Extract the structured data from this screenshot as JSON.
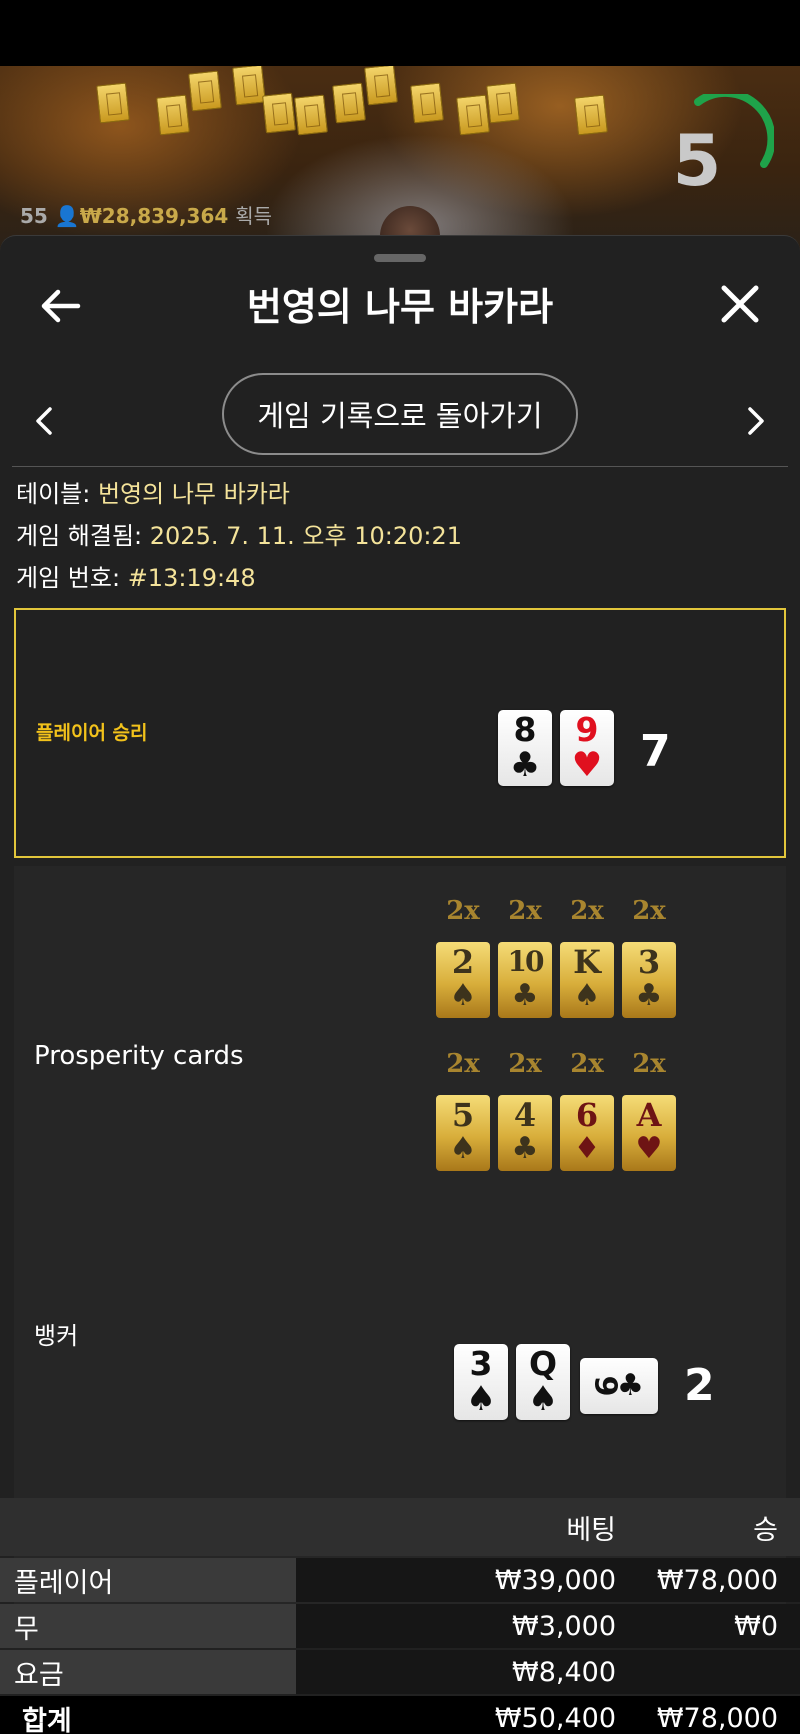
{
  "scene": {
    "lantern_icons": "lantern",
    "timer": "5",
    "player_count": "55",
    "winnings": "₩28,839,364",
    "winnings_suffix": "획득"
  },
  "header": {
    "title": "번영의 나무 바카라",
    "back_icon": "arrow-left-icon",
    "close_icon": "close-icon"
  },
  "nav": {
    "back_to_history": "게임 기록으로 돌아가기",
    "prev_icon": "chevron-left-icon",
    "next_icon": "chevron-right-icon"
  },
  "meta": {
    "table_label": "테이블:",
    "table_value": "번영의 나무 바카라",
    "resolved_label": "게임 해결됨:",
    "resolved_value": "2025. 7. 11. 오후 10:20:21",
    "number_label": "게임 번호:",
    "number_value": "#13:19:48"
  },
  "player": {
    "outcome": "플레이어 승리",
    "cards": [
      {
        "rank": "8",
        "suit": "♣",
        "color": "black"
      },
      {
        "rank": "9",
        "suit": "♥",
        "color": "red"
      }
    ],
    "score": "7"
  },
  "prosperity": {
    "label": "Prosperity cards",
    "rows": [
      [
        {
          "mult": "2x",
          "rank": "2",
          "suit": "♠",
          "color": "dark"
        },
        {
          "mult": "2x",
          "rank": "10",
          "suit": "♣",
          "color": "dark"
        },
        {
          "mult": "2x",
          "rank": "K",
          "suit": "♠",
          "color": "dark"
        },
        {
          "mult": "2x",
          "rank": "3",
          "suit": "♣",
          "color": "dark"
        }
      ],
      [
        {
          "mult": "2x",
          "rank": "5",
          "suit": "♠",
          "color": "dark"
        },
        {
          "mult": "2x",
          "rank": "4",
          "suit": "♣",
          "color": "dark"
        },
        {
          "mult": "2x",
          "rank": "6",
          "suit": "♦",
          "color": "red"
        },
        {
          "mult": "2x",
          "rank": "A",
          "suit": "♥",
          "color": "red"
        }
      ]
    ]
  },
  "banker": {
    "label": "뱅커",
    "cards": [
      {
        "rank": "3",
        "suit": "♠",
        "color": "black"
      },
      {
        "rank": "Q",
        "suit": "♠",
        "color": "black"
      },
      {
        "rank": "9",
        "suit": "♣",
        "color": "black"
      }
    ],
    "score": "2"
  },
  "bets": {
    "headers": {
      "label": "",
      "bet": "베팅",
      "win": "승"
    },
    "rows": [
      {
        "label": "플레이어",
        "bet": "₩39,000",
        "win": "₩78,000"
      },
      {
        "label": "무",
        "bet": "₩3,000",
        "win": "₩0"
      },
      {
        "label": "요금",
        "bet": "₩8,400",
        "win": ""
      },
      {
        "label": "합계",
        "bet": "₩50,400",
        "win": "₩78,000"
      }
    ]
  },
  "colors": {
    "accent_gold": "#e2c63b",
    "value_text": "#f4e39a",
    "timer_green": "#1fa34a",
    "sheet_bg": "#212121"
  }
}
